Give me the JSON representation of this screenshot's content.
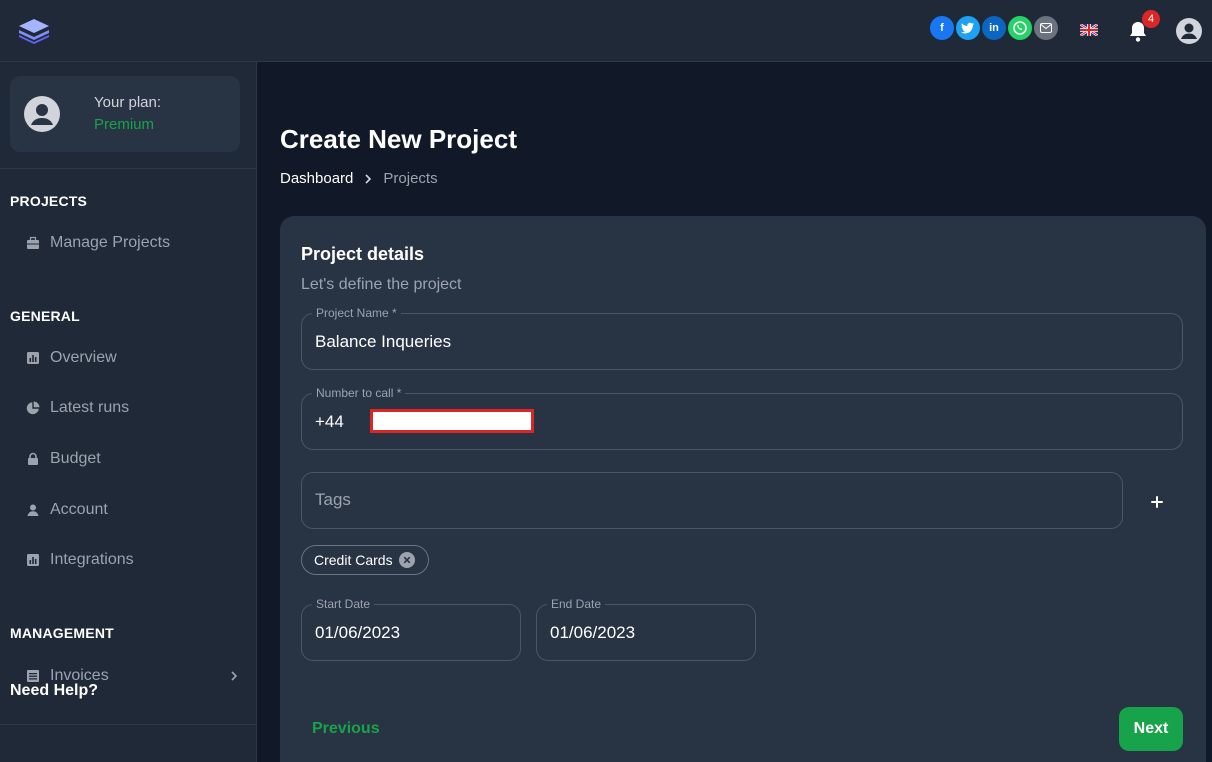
{
  "header": {
    "social_icons": [
      "facebook-icon",
      "twitter-icon",
      "linkedin-icon",
      "whatsapp-icon",
      "email-icon"
    ],
    "notification_count": "4",
    "colors": {
      "facebook": "#1877f2",
      "twitter": "#1da1f2",
      "linkedin": "#0a66c2",
      "whatsapp": "#25d366",
      "email": "#6b7280"
    }
  },
  "sidebar": {
    "plan_label": "Your plan:",
    "plan_value": "Premium",
    "sections": [
      {
        "title": "PROJECTS",
        "items": [
          {
            "label": "Manage Projects",
            "icon": "briefcase-icon"
          }
        ]
      },
      {
        "title": "GENERAL",
        "items": [
          {
            "label": "Overview",
            "icon": "chart-icon"
          },
          {
            "label": "Latest runs",
            "icon": "pie-icon"
          },
          {
            "label": "Budget",
            "icon": "lock-icon"
          },
          {
            "label": "Account",
            "icon": "user-icon"
          },
          {
            "label": "Integrations",
            "icon": "chart-icon"
          }
        ]
      },
      {
        "title": "MANAGEMENT",
        "items": [
          {
            "label": "Invoices",
            "icon": "invoice-icon"
          }
        ]
      }
    ],
    "help": "Need Help?"
  },
  "main": {
    "title": "Create New Project",
    "breadcrumb": {
      "home": "Dashboard",
      "current": "Projects"
    }
  },
  "form": {
    "title": "Project details",
    "subtitle": "Let's define the project",
    "project_name": {
      "label": "Project Name *",
      "value": "Balance Inqueries"
    },
    "number_to_call": {
      "label": "Number to call *",
      "value": "+44"
    },
    "tags": {
      "placeholder": "Tags",
      "chips": [
        "Credit Cards"
      ]
    },
    "start_date": {
      "label": "Start Date",
      "value": "01/06/2023"
    },
    "end_date": {
      "label": "End Date",
      "value": "01/06/2023"
    },
    "previous_label": "Previous",
    "next_label": "Next"
  },
  "colors": {
    "accent": "#16a34a",
    "background": "#111827",
    "panel": "#1f2937",
    "card": "#283344"
  }
}
